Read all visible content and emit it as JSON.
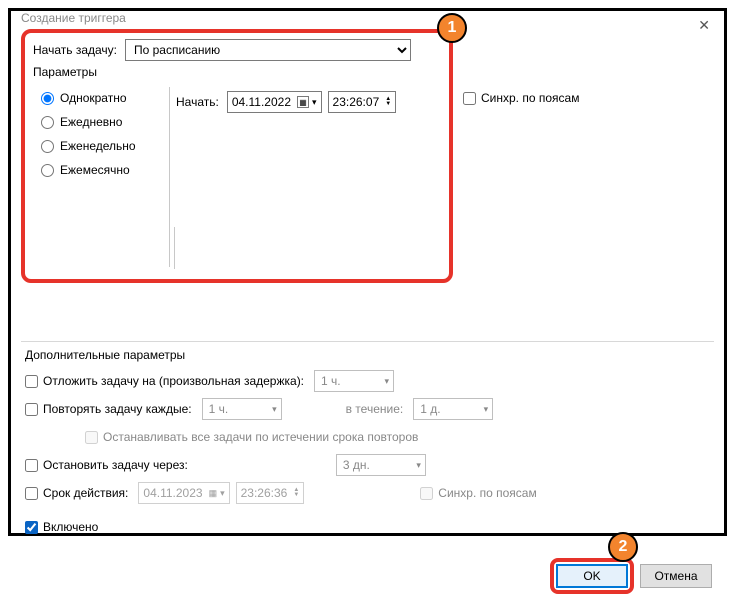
{
  "window": {
    "title": "Создание триггера"
  },
  "badges": {
    "one": "1",
    "two": "2"
  },
  "begin": {
    "label": "Начать задачу:",
    "selected": "По расписанию"
  },
  "params": {
    "label": "Параметры",
    "radios": {
      "once": "Однократно",
      "daily": "Ежедневно",
      "weekly": "Еженедельно",
      "monthly": "Ежемесячно"
    },
    "start_label": "Начать:",
    "date": "04.11.2022",
    "time": "23:26:07",
    "sync_label": "Синхр. по поясам"
  },
  "advanced": {
    "label": "Дополнительные параметры",
    "delay_label": "Отложить задачу на (произвольная задержка):",
    "delay_value": "1 ч.",
    "repeat_label": "Повторять задачу каждые:",
    "repeat_value": "1 ч.",
    "duration_label": "в течение:",
    "duration_value": "1 д.",
    "stop_all_label": "Останавливать все задачи по истечении срока повторов",
    "stop_after_label": "Остановить задачу через:",
    "stop_after_value": "3 дн.",
    "expire_label": "Срок действия:",
    "expire_date": "04.11.2023",
    "expire_time": "23:26:36",
    "sync_label": "Синхр. по поясам",
    "enabled_label": "Включено"
  },
  "buttons": {
    "ok": "OK",
    "cancel": "Отмена"
  }
}
